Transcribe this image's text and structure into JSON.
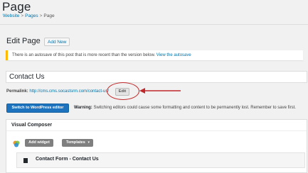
{
  "header": {
    "title": "Page",
    "breadcrumb": [
      "Website",
      "Pages",
      "Page"
    ]
  },
  "editor": {
    "heading": "Edit Page",
    "add_new_label": "Add New",
    "notice_text": "There is an autosave of this post that is more recent than the version below.",
    "notice_link": "View the autosave",
    "title_value": "Contact Us",
    "permalink_label": "Permalink:",
    "permalink_url": "http://cms.cms.socastsrm.com/contact-us/",
    "edit_label": "Edit",
    "switch_label": "Switch to WordPress editor",
    "warning_label": "Warning:",
    "warning_text": "Switching editors could cause some formatting and content to be permanently lost. Remember to save first."
  },
  "visual_composer": {
    "title": "Visual Composer",
    "add_widget_label": "Add widget",
    "templates_label": "Templates",
    "widget_title": "Contact Form - Contact Us"
  },
  "colors": {
    "accent": "#0073aa",
    "annotation": "#c0282a",
    "notice_border": "#ffb900"
  }
}
